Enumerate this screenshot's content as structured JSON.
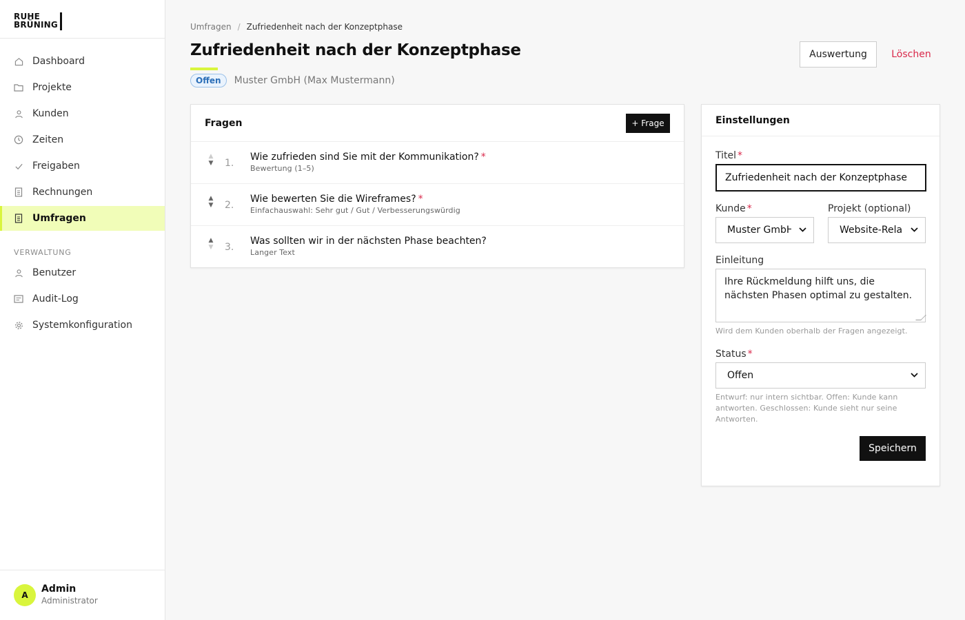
{
  "brand": {
    "line1": "RUHE",
    "line2": "BRÜNING"
  },
  "sidebar": {
    "items": [
      {
        "label": "Dashboard",
        "icon": "home-icon"
      },
      {
        "label": "Projekte",
        "icon": "folder-icon"
      },
      {
        "label": "Kunden",
        "icon": "user-icon"
      },
      {
        "label": "Zeiten",
        "icon": "clock-icon"
      },
      {
        "label": "Freigaben",
        "icon": "check-icon"
      },
      {
        "label": "Rechnungen",
        "icon": "document-icon"
      },
      {
        "label": "Umfragen",
        "icon": "survey-icon",
        "active": true
      }
    ],
    "section_label": "VERWALTUNG",
    "admin_items": [
      {
        "label": "Benutzer",
        "icon": "user-icon"
      },
      {
        "label": "Audit-Log",
        "icon": "log-icon"
      },
      {
        "label": "Systemkonfiguration",
        "icon": "gear-icon"
      }
    ]
  },
  "user": {
    "initial": "A",
    "name": "Admin",
    "role": "Administrator"
  },
  "breadcrumb": {
    "parent": "Umfragen",
    "separator": "/",
    "current": "Zufriedenheit nach der Konzeptphase"
  },
  "header": {
    "title": "Zufriedenheit nach der Konzeptphase",
    "status_badge": "Offen",
    "client": "Muster GmbH (Max Mustermann)",
    "evaluation_button": "Auswertung",
    "delete_button": "Löschen"
  },
  "questions": {
    "title": "Fragen",
    "add_button": "+ Frage",
    "items": [
      {
        "number": "1.",
        "text": "Wie zufrieden sind Sie mit der Kommunikation?",
        "required": "*",
        "type": "Bewertung (1–5)"
      },
      {
        "number": "2.",
        "text": "Wie bewerten Sie die Wireframes?",
        "required": "*",
        "type": "Einfachauswahl: Sehr gut / Gut / Verbesserungswürdig"
      },
      {
        "number": "3.",
        "text": "Was sollten wir in der nächsten Phase beachten?",
        "required": "",
        "type": "Langer Text"
      }
    ]
  },
  "settings": {
    "title": "Einstellungen",
    "title_label": "Titel",
    "title_value": "Zufriedenheit nach der Konzeptphase",
    "client_label": "Kunde",
    "client_value": "Muster GmbH (",
    "project_label": "Projekt (optional)",
    "project_value": "Website-Relau",
    "intro_label": "Einleitung",
    "intro_value": "Ihre Rückmeldung hilft uns, die nächsten Phasen optimal zu gestalten.",
    "intro_hint": "Wird dem Kunden oberhalb der Fragen angezeigt.",
    "status_label": "Status",
    "status_value": "Offen",
    "status_hint": "Entwurf: nur intern sichtbar. Offen: Kunde kann antworten. Geschlossen: Kunde sieht nur seine Antworten.",
    "required_mark": "*",
    "save_button": "Speichern"
  },
  "colors": {
    "accent": "#d9f53d",
    "danger": "#d9284a",
    "badge_blue": "#2c6fb8"
  }
}
